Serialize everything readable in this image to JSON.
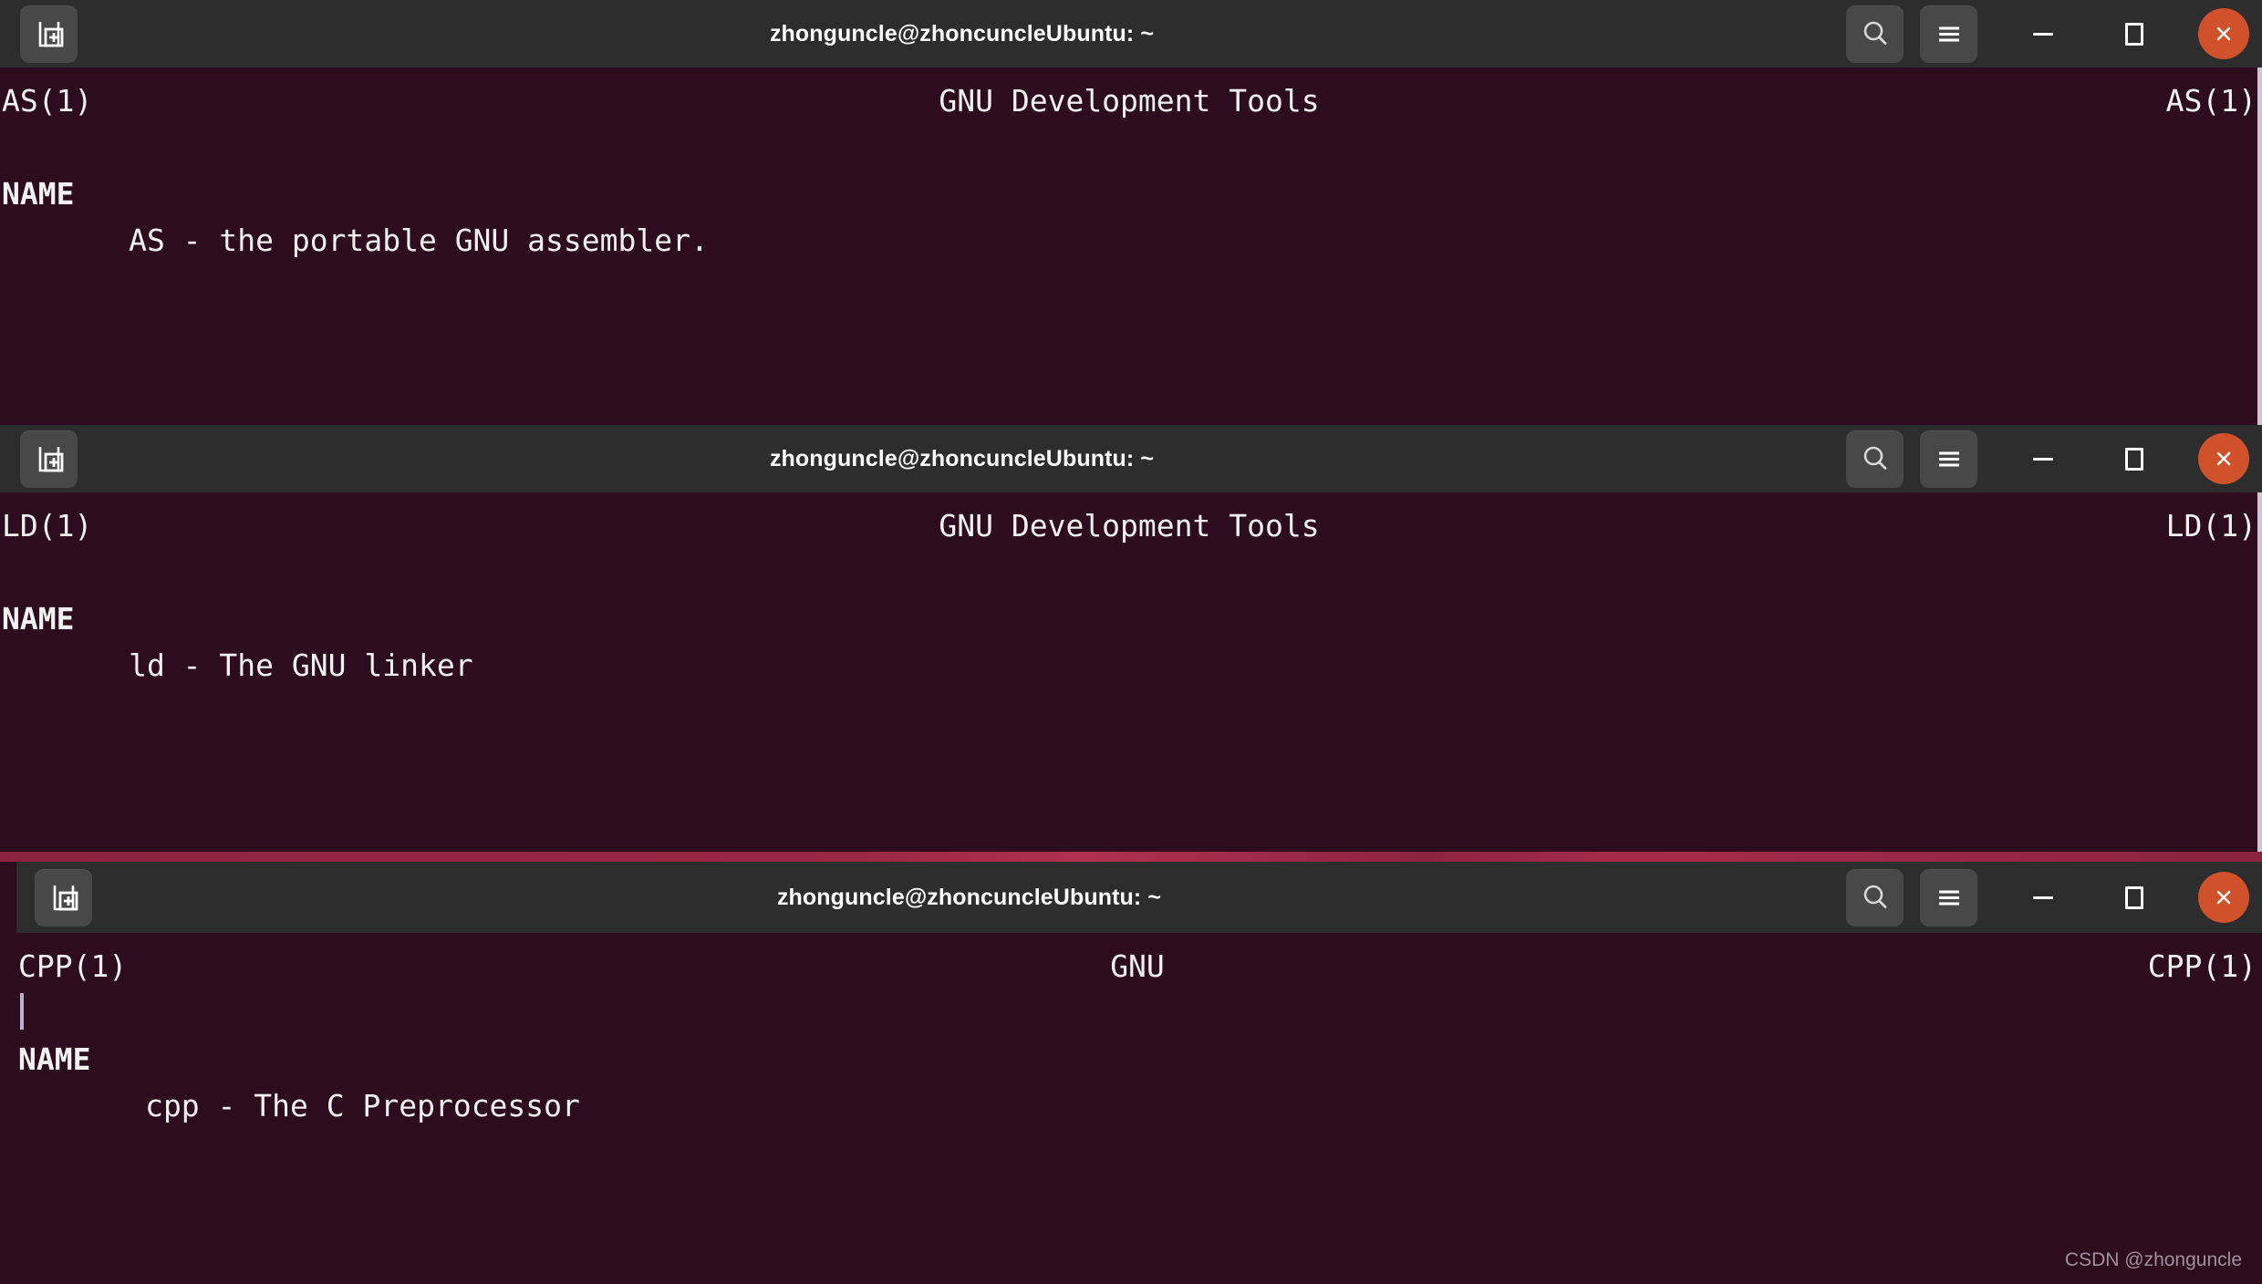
{
  "window_title": "zhonguncle@zhoncuncleUbuntu: ~",
  "titlebar": {
    "new_tab_label": "new-tab",
    "search_label": "search",
    "menu_label": "menu",
    "minimize_label": "minimize",
    "maximize_label": "maximize",
    "close_label": "close"
  },
  "colors": {
    "titlebar_bg": "#2d2d2d",
    "terminal_bg": "#2d0c1e",
    "close_button": "#d0512b",
    "tool_button": "#484848",
    "text": "#f2f2f2",
    "separator": "#9a2744",
    "scrollbar": "#cfc7d4"
  },
  "windows": [
    {
      "id": "window-as",
      "title": "zhonguncle@zhoncuncleUbuntu: ~",
      "man_header": {
        "left": "AS(1)",
        "center": "GNU Development Tools",
        "right": "AS(1)"
      },
      "section_title": "NAME",
      "body_line": "       AS - the portable GNU assembler."
    },
    {
      "id": "window-ld",
      "title": "zhonguncle@zhoncuncleUbuntu: ~",
      "man_header": {
        "left": "LD(1)",
        "center": "GNU Development Tools",
        "right": "LD(1)"
      },
      "section_title": "NAME",
      "body_line": "       ld - The GNU linker"
    },
    {
      "id": "window-cpp",
      "title": "zhonguncle@zhoncuncleUbuntu: ~",
      "man_header": {
        "left": "CPP(1)",
        "center": "GNU",
        "right": "CPP(1)"
      },
      "section_title": "NAME",
      "body_line": "       cpp - The C Preprocessor"
    }
  ],
  "watermark": "CSDN @zhonguncle"
}
